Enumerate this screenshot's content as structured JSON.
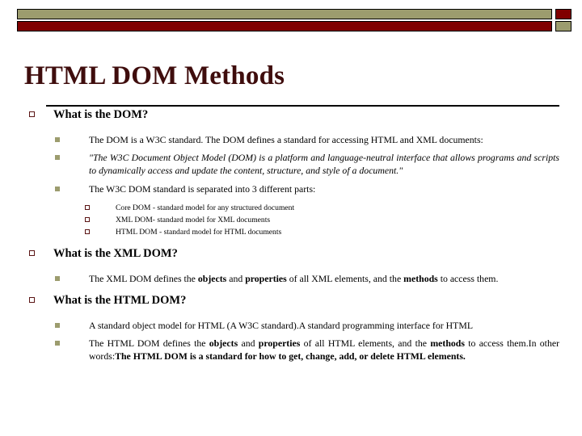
{
  "slide": {
    "title": "HTML DOM Methods",
    "theme": {
      "accent_olive": "#9c9c6e",
      "accent_maroon": "#800000",
      "title_color": "#3f0d0d",
      "bullet_border": "#5a1414",
      "background": "#ffffff"
    },
    "header_decoration": {
      "top_bar_color": "#9c9c6e",
      "bottom_bar_color": "#800000",
      "top_cap_color": "#800000",
      "bottom_cap_color": "#9c9c6e"
    },
    "sections": [
      {
        "heading": "What is the DOM?",
        "items": [
          {
            "level": 2,
            "style": "normal",
            "text": "The DOM is a W3C standard. The DOM defines a standard for accessing HTML and XML documents:"
          },
          {
            "level": 2,
            "style": "italic",
            "text": "\"The W3C Document Object Model (DOM) is a platform and language-neutral interface that allows programs and scripts to dynamically access and update the content, structure, and style of a document.\""
          },
          {
            "level": 2,
            "style": "normal",
            "text": "The W3C DOM standard is separated into 3 different parts:"
          }
        ],
        "subitems": [
          "Core DOM - standard model for any structured document",
          "XML DOM- standard model for XML documents",
          "HTML DOM - standard model for HTML documents"
        ]
      },
      {
        "heading": "What is the XML DOM?",
        "items": [
          {
            "level": 2,
            "style": "normal",
            "runs": [
              {
                "t": "The XML DOM defines the ",
                "b": false
              },
              {
                "t": "objects",
                "b": true
              },
              {
                "t": " and ",
                "b": false
              },
              {
                "t": "properties",
                "b": true
              },
              {
                "t": " of all XML elements, and the ",
                "b": false
              },
              {
                "t": "methods",
                "b": true
              },
              {
                "t": " to access them.",
                "b": false
              }
            ]
          }
        ]
      },
      {
        "heading": "What is the HTML DOM?",
        "items": [
          {
            "level": 2,
            "style": "normal",
            "runs": [
              {
                "t": "A standard object model for HTML (A W3C standard).A standard programming interface for HTML",
                "b": false
              }
            ]
          },
          {
            "level": 2,
            "style": "normal",
            "runs": [
              {
                "t": "The HTML DOM defines the ",
                "b": false
              },
              {
                "t": "objects",
                "b": true
              },
              {
                "t": " and ",
                "b": false
              },
              {
                "t": "properties",
                "b": true
              },
              {
                "t": " of all HTML elements, and the ",
                "b": false
              },
              {
                "t": "methods",
                "b": true
              },
              {
                "t": " to access them.In other words:",
                "b": false
              },
              {
                "t": "The HTML DOM is a standard for how to get, change, add, or delete HTML elements.",
                "b": true
              }
            ]
          }
        ]
      }
    ]
  }
}
